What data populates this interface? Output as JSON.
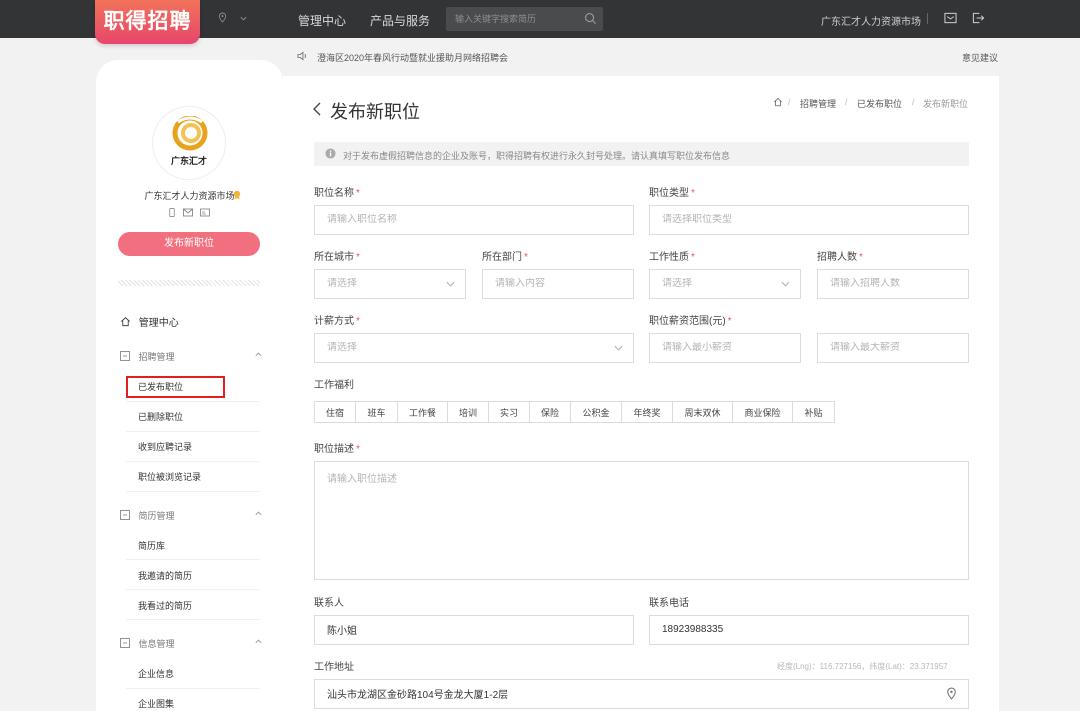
{
  "brand": {
    "logo_text": "职得招聘"
  },
  "topnav": {
    "items": [
      "管理中心",
      "产品与服务"
    ],
    "search_placeholder": "输入关键字搜索简历",
    "company": "广东汇才人力资源市场"
  },
  "notice": {
    "text": "澄海区2020年春风行动暨就业援助月网络招聘会",
    "feedback": "意见建议"
  },
  "sidebar": {
    "avatar_text": "广东汇才",
    "company_name": "广东汇才人力资源市场",
    "publish_button": "发布新职位",
    "home": "管理中心",
    "groups": [
      {
        "title": "招聘管理",
        "items": [
          "已发布职位",
          "已删除职位",
          "收到应聘记录",
          "职位被浏览记录"
        ]
      },
      {
        "title": "简历管理",
        "items": [
          "简历库",
          "我邀请的简历",
          "我看过的简历"
        ]
      },
      {
        "title": "信息管理",
        "items": [
          "企业信息",
          "企业图集"
        ]
      }
    ]
  },
  "page": {
    "title": "发布新职位",
    "breadcrumb": [
      "招聘管理",
      "已发布职位",
      "发布新职位"
    ],
    "tip": "对于发布虚假招聘信息的企业及账号，职得招聘有权进行永久封号处理。请认真填写职位发布信息"
  },
  "form": {
    "job_name": {
      "label": "职位名称",
      "placeholder": "请输入职位名称"
    },
    "job_type": {
      "label": "职位类型",
      "placeholder": "请选择职位类型"
    },
    "city": {
      "label": "所在城市",
      "placeholder": "请选择"
    },
    "department": {
      "label": "所在部门",
      "placeholder": "请输入内容"
    },
    "work_nature": {
      "label": "工作性质",
      "placeholder": "请选择"
    },
    "headcount": {
      "label": "招聘人数",
      "placeholder": "请输入招聘人数"
    },
    "salary_method": {
      "label": "计薪方式",
      "placeholder": "请选择"
    },
    "salary_range": {
      "label": "职位薪资范围(元)",
      "min_placeholder": "请输入最小薪资",
      "max_placeholder": "请输入最大薪资"
    },
    "benefits": {
      "label": "工作福利",
      "tags": [
        "住宿",
        "班车",
        "工作餐",
        "培训",
        "实习",
        "保险",
        "公积金",
        "年终奖",
        "周末双休",
        "商业保险",
        "补贴"
      ]
    },
    "description": {
      "label": "职位描述",
      "placeholder": "请输入职位描述"
    },
    "contact": {
      "label": "联系人",
      "value": "陈小姐"
    },
    "phone": {
      "label": "联系电话",
      "value": "18923988335"
    },
    "address": {
      "label": "工作地址",
      "coords": "经度(Lng)：116.727156，纬度(Lat)：23.371957",
      "value": "汕头市龙湖区金砂路104号金龙大厦1-2层"
    }
  },
  "colors": {
    "accent": "#f16f7e",
    "topbar": "#333436",
    "highlight": "#e02020"
  }
}
